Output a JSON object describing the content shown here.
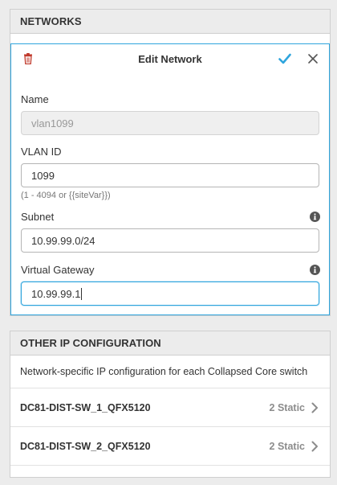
{
  "networks": {
    "header": "NETWORKS",
    "edit_form": {
      "title": "Edit Network",
      "fields": {
        "name": {
          "label": "Name",
          "value": "vlan1099",
          "disabled": true
        },
        "vlan_id": {
          "label": "VLAN ID",
          "value": "1099",
          "hint": "(1 - 4094 or {{siteVar}})"
        },
        "subnet": {
          "label": "Subnet",
          "value": "10.99.99.0/24"
        },
        "virtual_gateway": {
          "label": "Virtual Gateway",
          "value": "10.99.99.1"
        }
      }
    }
  },
  "other_ip": {
    "header": "OTHER IP CONFIGURATION",
    "description": "Network-specific IP configuration for each Collapsed Core switch",
    "switches": [
      {
        "name": "DC81-DIST-SW_1_QFX5120",
        "status": "2 Static"
      },
      {
        "name": "DC81-DIST-SW_2_QFX5120",
        "status": "2 Static"
      }
    ]
  },
  "colors": {
    "accent": "#2fa5dd",
    "delete": "#c0392b",
    "panel_header_bg": "#ececec"
  },
  "icons": {
    "delete": "trash-icon",
    "save": "check-icon",
    "cancel": "close-icon",
    "info": "info-icon",
    "row_nav": "chevron-right-icon"
  }
}
